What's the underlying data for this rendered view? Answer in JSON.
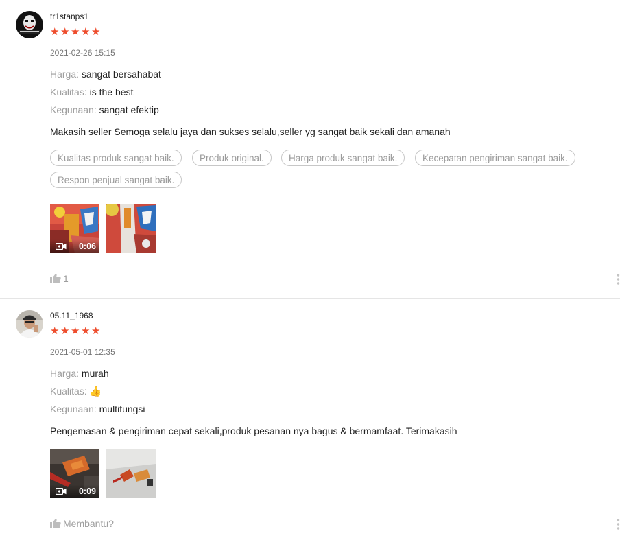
{
  "reviews": [
    {
      "author": "tr1stanps1",
      "rating": 5,
      "date": "2021-02-26 15:15",
      "attributes": [
        {
          "label": "Harga:",
          "value": "sangat bersahabat"
        },
        {
          "label": "Kualitas:",
          "value": "is the best"
        },
        {
          "label": "Kegunaan:",
          "value": "sangat efektip"
        }
      ],
      "comment": "Makasih seller Semoga selalu jaya dan sukses selalu,seller yg sangat baik sekali dan amanah",
      "tags": [
        "Kualitas produk sangat baik.",
        "Produk original.",
        "Harga produk sangat baik.",
        "Kecepatan pengiriman sangat baik.",
        "Respon penjual sangat baik."
      ],
      "video_duration": "0:06",
      "like_text": "1"
    },
    {
      "author": "05.11_1968",
      "rating": 5,
      "date": "2021-05-01 12:35",
      "attributes": [
        {
          "label": "Harga:",
          "value": "murah"
        },
        {
          "label": "Kualitas:",
          "value": "👍"
        },
        {
          "label": "Kegunaan:",
          "value": "multifungsi"
        }
      ],
      "comment": "Pengemasan & pengiriman cepat sekali,produk pesanan nya bagus & bermamfaat. Terimakasih",
      "tags": [],
      "video_duration": "0:09",
      "like_text": "Membantu?"
    }
  ],
  "colors": {
    "star": "#ee4d2d",
    "muted": "#9e9e9e",
    "tag_border": "#c7c7c7"
  }
}
